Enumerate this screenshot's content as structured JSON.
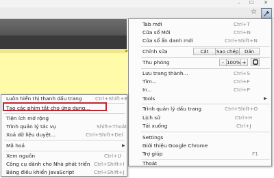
{
  "window": {
    "minimize": "–",
    "maximize": "☐",
    "close": "✕"
  },
  "toolbar": {
    "star_icon": "☆",
    "wrench_icon": "wrench"
  },
  "menu": {
    "new_tab": {
      "label": "Tab mới",
      "shortcut": "Ctrl+T"
    },
    "new_window": {
      "label": "Cửa sổ Mới",
      "shortcut": "Ctrl+N"
    },
    "incognito": {
      "label": "Cửa sổ ẩn danh mới",
      "shortcut": "Ctrl+Shift+N"
    },
    "edit": {
      "label": "Chỉnh sửa",
      "cut": "Cắt",
      "copy": "Sao chép",
      "paste": "Dán"
    },
    "zoom": {
      "label": "Thu phóng",
      "minus": "-",
      "value": "100%",
      "plus": "+"
    },
    "save_page": {
      "label": "Lưu trang thành...",
      "shortcut": "Ctrl+S"
    },
    "find": {
      "label": "Tìm...",
      "shortcut": "Ctrl+F"
    },
    "print": {
      "label": "In...",
      "shortcut": "Ctrl+P"
    },
    "tools": {
      "label": "Tools"
    },
    "bookmark_manager": {
      "label": "Trình quản lý dấu trang",
      "shortcut": "Ctrl+Shift+O"
    },
    "history": {
      "label": "Lịch sử",
      "shortcut": "Ctrl+H"
    },
    "downloads": {
      "label": "Tải xuống",
      "shortcut": "Ctrl+J"
    },
    "settings": {
      "label": "Settings"
    },
    "about": {
      "label": "Giới thiệu Google Chrome"
    },
    "help": {
      "label": "Trợ giúp",
      "shortcut": "F1"
    },
    "exit": {
      "label": "Thoát"
    }
  },
  "submenu": {
    "show_bookmarks_bar": {
      "label": "Luôn hiển thị thanh dấu trang",
      "shortcut": "Ctrl+Shift+B"
    },
    "create_shortcuts": {
      "label": "Tạo các phím tắt cho ứng dụng..."
    },
    "extensions": {
      "label": "Tiện ích mở rộng"
    },
    "task_manager": {
      "label": "Trình quản lý tác vụ",
      "shortcut": "Shift+Thoát"
    },
    "clear_data": {
      "label": "Xoá dữ liệu duyệt...",
      "shortcut": "Ctrl+Shift+Del"
    },
    "encoding": {
      "label": "Mã hoá"
    },
    "view_source": {
      "label": "Xem nguồn",
      "shortcut": "Ctrl+U"
    },
    "dev_tools": {
      "label": "Công cụ dành cho Nhà phát triển",
      "shortcut": "Ctrl+Shift+I"
    },
    "js_console": {
      "label": "Bảng điều khiển JavaScript",
      "shortcut": "Ctrl+Shift+J"
    }
  }
}
